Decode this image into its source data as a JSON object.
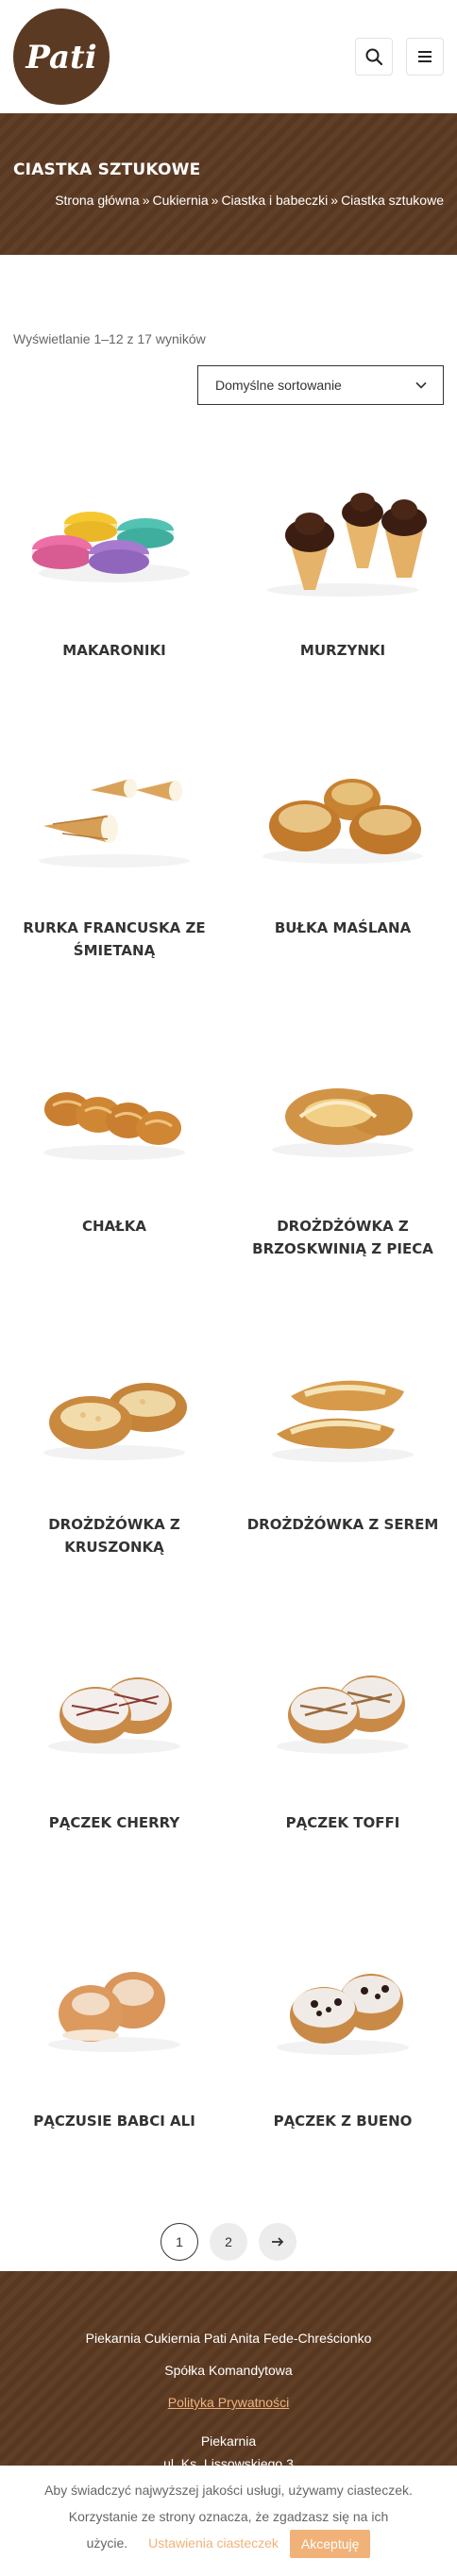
{
  "logo": {
    "text": "Pati"
  },
  "icons": {
    "search": "search-icon",
    "menu": "hamburger-menu-icon",
    "next": "arrow-right-icon",
    "sort": "chevron-down-icon"
  },
  "colors": {
    "brand_brown": "#5c3a22",
    "accent": "#f1b27a"
  },
  "page": {
    "title": "CIASTKA SZTUKOWE",
    "breadcrumb": [
      "Strona główna",
      "Cukiernia",
      "Ciastka i babeczki",
      "Ciastka sztukowe"
    ],
    "breadcrumb_sep": "»"
  },
  "results": {
    "count_text": "Wyświetlanie 1–12 z 17 wyników",
    "sort_value": "Domyślne sortowanie"
  },
  "products": [
    {
      "name": "MAKARONIKI",
      "img": "macarons-image"
    },
    {
      "name": "MURZYNKI",
      "img": "chocolate-cones-image"
    },
    {
      "name": "RURKA FRANCUSKA ZE ŚMIETANĄ",
      "img": "cream-horns-image"
    },
    {
      "name": "BUŁKA MAŚLANA",
      "img": "butter-buns-image"
    },
    {
      "name": "CHAŁKA",
      "img": "challah-image"
    },
    {
      "name": "DROŻDŻÓWKA Z BRZOSKWINIĄ Z PIECA",
      "img": "peach-bun-image"
    },
    {
      "name": "DROŻDŻÓWKA Z KRUSZONKĄ",
      "img": "crumble-bun-image"
    },
    {
      "name": "DROŻDŻÓWKA Z SEREM",
      "img": "cheese-bun-image"
    },
    {
      "name": "PĄCZEK CHERRY",
      "img": "cherry-donut-image"
    },
    {
      "name": "PĄCZEK TOFFI",
      "img": "toffee-donut-image"
    },
    {
      "name": "PĄCZUSIE BABCI ALI",
      "img": "mini-donuts-image"
    },
    {
      "name": "PĄCZEK Z BUENO",
      "img": "bueno-donut-image"
    }
  ],
  "pagination": {
    "pages": [
      "1",
      "2"
    ],
    "current": "1"
  },
  "footer": {
    "company": "Piekarnia Cukiernia Pati Anita Fede-Chreścionko",
    "company_type": "Spółka Komandytowa",
    "privacy_link": "Polityka Prywatności",
    "section": "Piekarnia",
    "address": "ul. Ks. Lissowskiego 3"
  },
  "cookie": {
    "line1": "Aby świadczyć najwyższej jakości usługi, używamy ciasteczek.",
    "line2": "Korzystanie ze strony oznacza, że zgadzasz się na ich",
    "line3": "użycie.",
    "settings": "Ustawienia ciasteczek",
    "accept": "Akceptuję"
  }
}
